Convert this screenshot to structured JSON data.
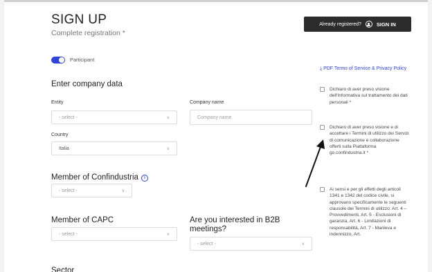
{
  "header": {
    "title": "SIGN UP",
    "subtitle": "Complete registration *",
    "signin_prefix": "Already registered?",
    "signin_label": "SIGN IN"
  },
  "toggle": {
    "label": "Participant",
    "state": "on",
    "color": "#2f43d6"
  },
  "company": {
    "section_title": "Enter company data",
    "entity_label": "Entity",
    "entity_value": "- select -",
    "company_name_label": "Company name",
    "company_name_placeholder": "Company name",
    "country_label": "Country",
    "country_value": "Italia"
  },
  "confindustria": {
    "section_title": "Member of Confindustria",
    "value": "- select -"
  },
  "capc": {
    "section_title": "Member of CAPC",
    "value": "- select -"
  },
  "b2b": {
    "section_title": "Are you interested in B2B meetings?",
    "value": "- select -"
  },
  "sector": {
    "section_title": "Sector"
  },
  "legal": {
    "pdf_link": "PDF Terms of Service & Privacy Policy",
    "consents": [
      "Dichiaro di aver preso visione dell'Informativa sul trattamento dei dati personali *",
      "Dichiaro di aver preso visione e di accettare i Termini di utilizzo dei Servizi di comunicazione e collaborazione offerti sulla Piattaforma go.confindustria.it *",
      "Ai sensi e per gli effetti degli articoli 1341 e 1342 del codice civile, si approvano specificamente le seguenti clausole dei Termini di utilizzo: Art. 4 – Provvedimenti, Art. 5 - Esclusioni di garanzia, Art. 6 - Limitazioni di responsabilità, Art. 7 - Manleva e indennizzo, Art."
    ]
  },
  "colors": {
    "accent": "#2f43d6",
    "dark_button": "#2c2c2c",
    "background": "#ffffff"
  }
}
